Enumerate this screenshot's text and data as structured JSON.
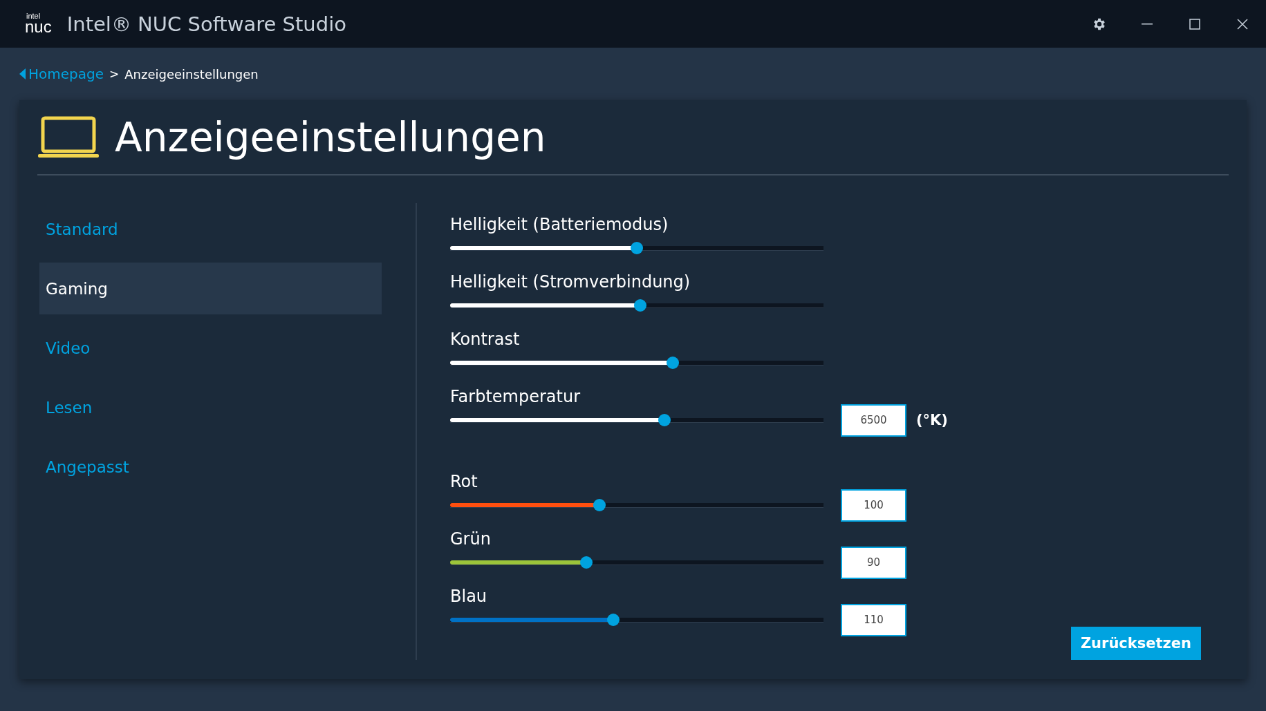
{
  "window": {
    "logo": {
      "top": "intel",
      "bottom": "nuc"
    },
    "title": "Intel® NUC Software Studio"
  },
  "breadcrumb": {
    "back_link": "Homepage",
    "separator": ">",
    "current": "Anzeigeeinstellungen"
  },
  "page": {
    "title": "Anzeigeeinstellungen"
  },
  "sidebar": {
    "items": [
      {
        "label": "Standard",
        "selected": false
      },
      {
        "label": "Gaming",
        "selected": true
      },
      {
        "label": "Video",
        "selected": false
      },
      {
        "label": "Lesen",
        "selected": false
      },
      {
        "label": "Angepasst",
        "selected": false
      }
    ]
  },
  "slider_groups": [
    [
      {
        "label": "Helligkeit (Batteriemodus)",
        "level": 0.5,
        "color": "#ffffff"
      },
      {
        "label": "Helligkeit (Stromverbindung)",
        "level": 0.51,
        "color": "#ffffff"
      },
      {
        "label": "Kontrast",
        "level": 0.6,
        "color": "#ffffff"
      },
      {
        "label": "Farbtemperatur",
        "level": 0.576,
        "color": "#ffffff",
        "value": "6500",
        "unit": "(°K)"
      }
    ],
    [
      {
        "label": "Rot",
        "level": 0.396,
        "color": "#ff4f0f",
        "value": "100"
      },
      {
        "label": "Grün",
        "level": 0.36,
        "color": "#9cc43a",
        "value": "90"
      },
      {
        "label": "Blau",
        "level": 0.435,
        "color": "#0071c5",
        "value": "110"
      }
    ]
  ],
  "reset_button": "Zurücksetzen"
}
